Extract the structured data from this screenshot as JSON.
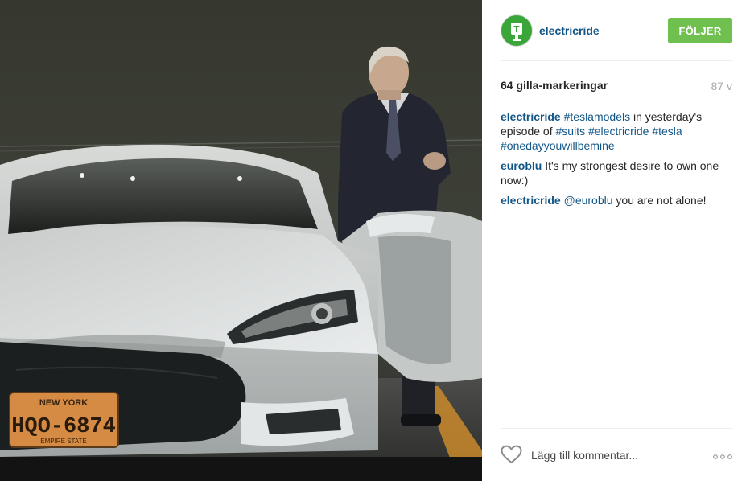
{
  "post": {
    "username": "electricride",
    "follow_label": "FÖLJER",
    "likes": "64 gilla-markeringar",
    "time": "87 v",
    "license_plate": {
      "state": "NEW YORK",
      "number": "HQO-6874",
      "bottom_text": "EMPIRE STATE"
    }
  },
  "comments": [
    {
      "user": "electricride",
      "parts": [
        {
          "text": "#teslamodels",
          "tag": true
        },
        {
          "text": " in yesterday's episode of ",
          "tag": false
        },
        {
          "text": "#suits",
          "tag": true
        },
        {
          "text": " ",
          "tag": false
        },
        {
          "text": "#electricride",
          "tag": true
        },
        {
          "text": " ",
          "tag": false
        },
        {
          "text": "#tesla",
          "tag": true
        },
        {
          "text": " ",
          "tag": false
        },
        {
          "text": "#onedayyouwillbemine",
          "tag": true
        }
      ]
    },
    {
      "user": "euroblu",
      "parts": [
        {
          "text": "It's my strongest desire to own one now:)",
          "tag": false
        }
      ]
    },
    {
      "user": "electricride",
      "parts": [
        {
          "text": "@euroblu",
          "tag": true
        },
        {
          "text": " you are not alone!",
          "tag": false
        }
      ]
    }
  ],
  "footer": {
    "comment_placeholder": "Lägg till kommentar..."
  },
  "icons": {
    "avatar": "tesla-logo-icon",
    "like": "heart-icon",
    "more": "more-options-icon"
  },
  "colors": {
    "link": "#125688",
    "follow_button": "#70c050",
    "avatar_bg": "#3aa63a"
  }
}
